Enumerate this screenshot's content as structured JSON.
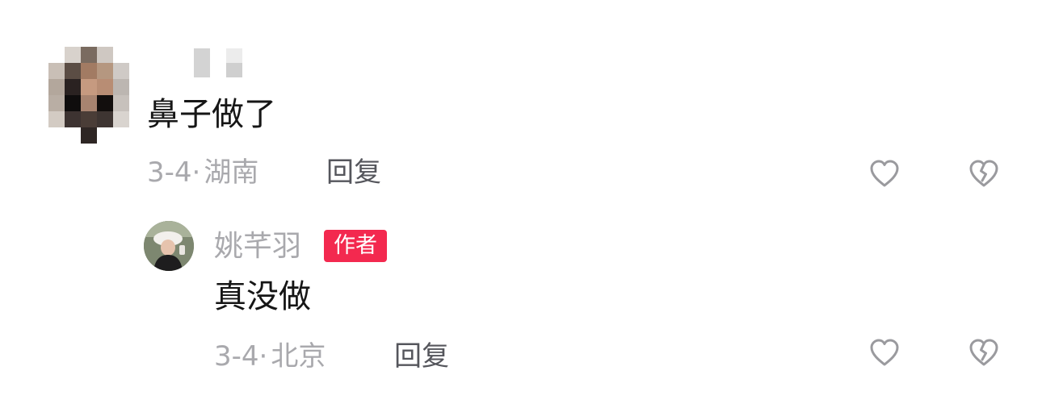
{
  "comment": {
    "username_masked": true,
    "text": "鼻子做了",
    "date": "3-4",
    "location": "湖南",
    "reply_label": "回复",
    "like_icon": "heart-outline-icon",
    "dislike_icon": "broken-heart-icon"
  },
  "reply": {
    "author_name": "姚芊羽",
    "author_badge": "作者",
    "text": "真没做",
    "date": "3-4",
    "location": "北京",
    "reply_label": "回复",
    "like_icon": "heart-outline-icon",
    "dislike_icon": "broken-heart-icon"
  },
  "colors": {
    "badge_bg": "#f3294f",
    "meta_text": "#a9a9ad",
    "body_text": "#161616",
    "reply_text": "#55565c",
    "icon_stroke": "#9a9a9e"
  },
  "meta_separator": "·"
}
